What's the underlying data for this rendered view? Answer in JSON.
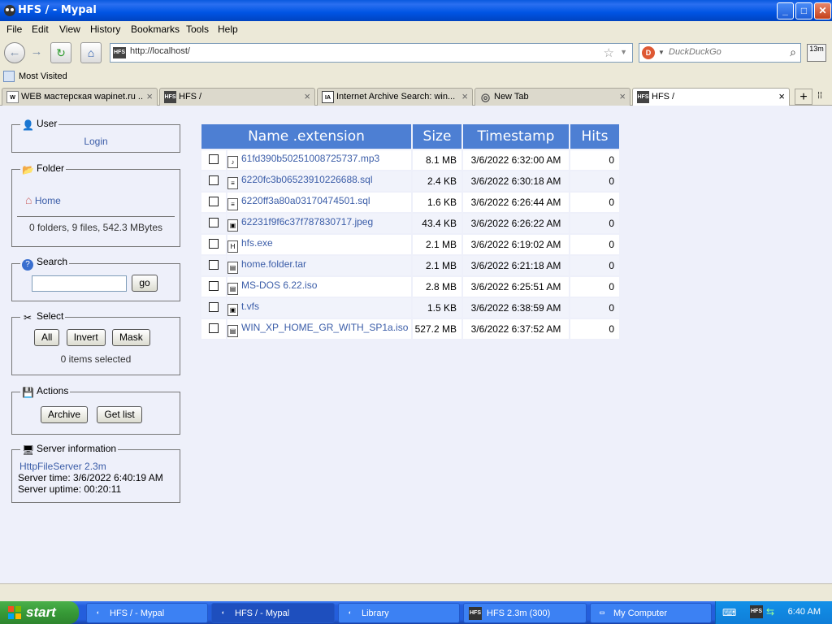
{
  "window": {
    "title": "HFS / - Mypal",
    "min": "_",
    "max": "□",
    "close": "✕"
  },
  "menu": [
    "File",
    "Edit",
    "View",
    "History",
    "Bookmarks",
    "Tools",
    "Help"
  ],
  "nav": {
    "back": "←",
    "forward": "→",
    "reload": "↻",
    "home": "⌂",
    "url": "http://localhost/",
    "site_icon": "HFS",
    "star": "☆",
    "drop": "▼"
  },
  "search": {
    "engine_icon": "D",
    "engine_drop": "▼",
    "placeholder": "DuckDuckGo",
    "icon": "⌕"
  },
  "addon": {
    "label": "13m"
  },
  "bookmarks": {
    "most_visited": "Most Visited"
  },
  "tabs": [
    {
      "title": "WEB мастерская wapinet.ru ...",
      "icon": "W"
    },
    {
      "title": "HFS /",
      "icon": "HFS"
    },
    {
      "title": "Internet Archive Search: win...",
      "icon": "IA"
    },
    {
      "title": "New Tab",
      "icon": "◎"
    },
    {
      "title": "HFS /",
      "icon": "HFS"
    }
  ],
  "tab_close": "×",
  "tab_new": "+",
  "tab_list": "⁞⁞",
  "sidebar": {
    "user": {
      "legend": "User",
      "icon": "👤",
      "login": "Login"
    },
    "folder": {
      "legend": "Folder",
      "icon": "📂",
      "home": "Home",
      "home_icon": "⌂",
      "stats": "0 folders, 9 files, 542.3 MBytes"
    },
    "search": {
      "legend": "Search",
      "icon": "?",
      "go": "go",
      "value": ""
    },
    "select": {
      "legend": "Select",
      "icon": "✂",
      "all": "All",
      "invert": "Invert",
      "mask": "Mask",
      "status": "0 items selected"
    },
    "actions": {
      "legend": "Actions",
      "icon": "💾",
      "archive": "Archive",
      "getlist": "Get list"
    },
    "server": {
      "legend": "Server information",
      "icon": "🖥",
      "version": "HttpFileServer 2.3m",
      "time": "Server time: 3/6/2022 6:40:19 AM",
      "uptime": "Server uptime: 00:20:11"
    }
  },
  "table": {
    "headers": {
      "name": "Name .extension",
      "size": "Size",
      "timestamp": "Timestamp",
      "hits": "Hits"
    },
    "rows": [
      {
        "name": "61fd390b50251008725737.mp3",
        "icon": "♪",
        "size": "8.1 MB",
        "timestamp": "3/6/2022 6:32:00 AM",
        "hits": "0"
      },
      {
        "name": "6220fc3b06523910226688.sql",
        "icon": "≡",
        "size": "2.4 KB",
        "timestamp": "3/6/2022 6:30:18 AM",
        "hits": "0"
      },
      {
        "name": "6220ff3a80a03170474501.sql",
        "icon": "≡",
        "size": "1.6 KB",
        "timestamp": "3/6/2022 6:26:44 AM",
        "hits": "0"
      },
      {
        "name": "62231f9f6c37f787830717.jpeg",
        "icon": "▣",
        "size": "43.4 KB",
        "timestamp": "3/6/2022 6:26:22 AM",
        "hits": "0"
      },
      {
        "name": "hfs.exe",
        "icon": "H",
        "size": "2.1 MB",
        "timestamp": "3/6/2022 6:19:02 AM",
        "hits": "0"
      },
      {
        "name": "home.folder.tar",
        "icon": "▤",
        "size": "2.1 MB",
        "timestamp": "3/6/2022 6:21:18 AM",
        "hits": "0"
      },
      {
        "name": "MS-DOS 6.22.iso",
        "icon": "▤",
        "size": "2.8 MB",
        "timestamp": "3/6/2022 6:25:51 AM",
        "hits": "0"
      },
      {
        "name": "t.vfs",
        "icon": "▣",
        "size": "1.5 KB",
        "timestamp": "3/6/2022 6:38:59 AM",
        "hits": "0"
      },
      {
        "name": "WIN_XP_HOME_GR_WITH_SP1a.iso",
        "icon": "▤",
        "size": "527.2 MB",
        "timestamp": "3/6/2022 6:37:52 AM",
        "hits": "0"
      }
    ]
  },
  "taskbar": {
    "start": "start",
    "items": [
      {
        "label": "HFS / - Mypal",
        "icon": "◐"
      },
      {
        "label": "HFS / - Mypal",
        "icon": "◐"
      },
      {
        "label": "Library",
        "icon": "◐"
      },
      {
        "label": "HFS 2.3m (300)",
        "icon": "HFS"
      },
      {
        "label": "My Computer",
        "icon": "▭"
      }
    ],
    "clock": "6:40 AM"
  },
  "colors": {
    "header_blue": "#4d7fd3",
    "link": "#3b5da8",
    "content_bg": "#eef0fa"
  }
}
